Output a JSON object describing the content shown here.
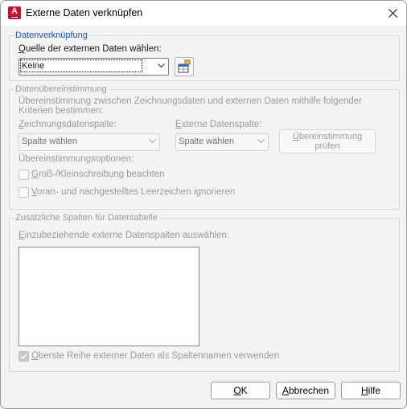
{
  "window": {
    "title": "Externe Daten verknüpfen",
    "app_icon_letter": "A",
    "close_glyph": "close-icon"
  },
  "datenverknuepfung": {
    "legend": "Datenverknüpfung",
    "source_label_u": "Q",
    "source_label_rest": "uelle der externen Daten wählen:",
    "source_value": "Keine"
  },
  "datenuebereinstimmung": {
    "legend": "Datenübereinstimmung",
    "description_line1": "Übereinstimmung zwischen Zeichnungsdaten und externen Daten mithilfe folgender",
    "description_line2": "Kriterien bestimmen:",
    "drawing_col_label_u": "Z",
    "drawing_col_label_rest": "eichnungsdatenspalte:",
    "drawing_col_value": "Spalte wählen",
    "external_col_label_u": "E",
    "external_col_label_rest": "xterne Datenspalte:",
    "external_col_value": "Spalte wählen",
    "check_button_line1_u": "Ü",
    "check_button_line1_rest": "bereinstimmung",
    "check_button_line2": "prüfen",
    "options_label": "Übereinstimmungsoptionen:",
    "case_sensitive_u": "G",
    "case_sensitive_rest": "roß-/Kleinschreibung beachten",
    "trim_spaces_u": "V",
    "trim_spaces_rest": "oran- und nachgestelltes Leerzeichen ignorieren"
  },
  "zusatzspalten": {
    "legend": "Zusätzliche Spalten für Datentabelle",
    "select_label_u": "E",
    "select_label_rest": "inzubeziehende externe Datenspalten auswählen:",
    "first_row_u": "O",
    "first_row_rest": "berste Reihe externer Daten als Spaltennamen verwenden",
    "first_row_checked": true
  },
  "buttons": {
    "ok_u": "O",
    "ok_rest": "K",
    "cancel_u": "A",
    "cancel_rest": "bbrechen",
    "help_u": "H",
    "help_rest": "ilfe"
  },
  "colors": {
    "accent_blue": "#1a4fb5",
    "app_red": "#c8102e",
    "disabled_text": "#9a9a9a"
  }
}
